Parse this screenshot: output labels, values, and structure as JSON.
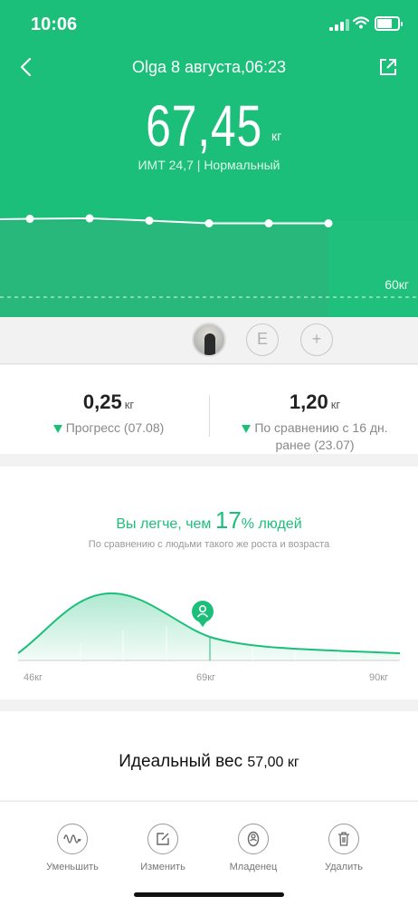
{
  "status": {
    "time": "10:06"
  },
  "header": {
    "title": "Olga 8 августа,06:23"
  },
  "weight": {
    "value": "67,45",
    "unit": "кг",
    "bmi": "ИМТ 24,7 | Нормальный"
  },
  "trend": {
    "goal_label": "60кг"
  },
  "users": {
    "e_label": "E",
    "add_label": "+"
  },
  "changes": {
    "progress": {
      "value": "0,25",
      "unit": "кг",
      "label": "Прогресс (07.08)"
    },
    "compare": {
      "value": "1,20",
      "unit": "кг",
      "label_line1": "По сравнению с 16 дн.",
      "label_line2": "ранее (23.07)"
    }
  },
  "comparison": {
    "headline_pre": "Вы легче, чем ",
    "percent": "17",
    "headline_post": "% людей",
    "subtitle": "По сравнению с людьми такого же роста и возраста",
    "axis_labels": [
      "46кг",
      "69кг",
      "90кг"
    ]
  },
  "ideal": {
    "label": "Идеальный вес",
    "value": "57,00 кг"
  },
  "actions": [
    {
      "label": "Уменьшить",
      "icon": "wave-icon"
    },
    {
      "label": "Изменить",
      "icon": "edit-icon"
    },
    {
      "label": "Младенец",
      "icon": "baby-icon"
    },
    {
      "label": "Удалить",
      "icon": "trash-icon"
    }
  ],
  "colors": {
    "accent": "#1bbf7a"
  }
}
